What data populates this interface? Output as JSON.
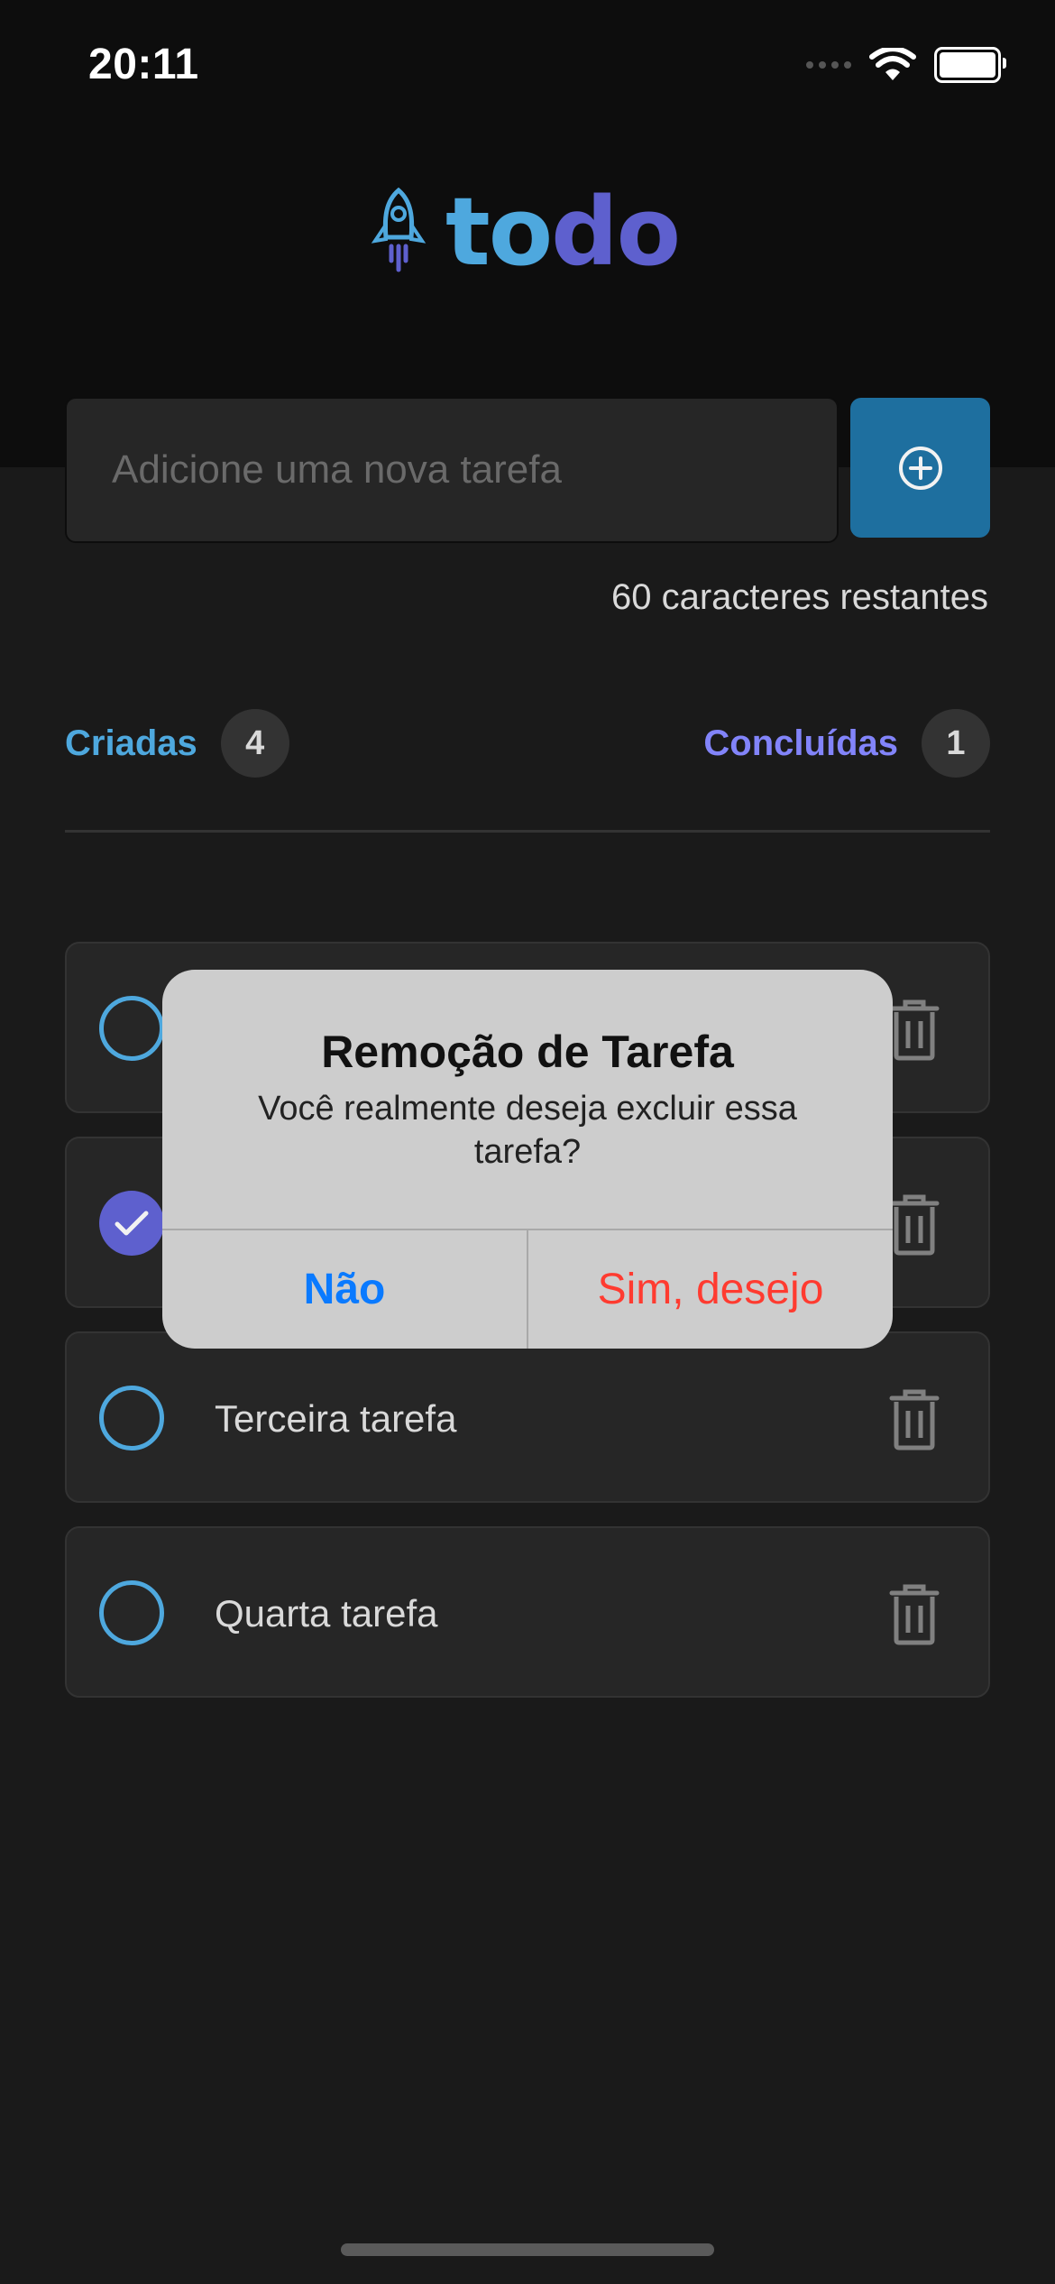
{
  "status_bar": {
    "time": "20:11"
  },
  "logo": {
    "part1": "to",
    "part2": "do"
  },
  "new_task": {
    "placeholder": "Adicione uma nova tarefa",
    "value": ""
  },
  "counter_text": "60 caracteres restantes",
  "tabs": {
    "created_label": "Criadas",
    "created_count": "4",
    "done_label": "Concluídas",
    "done_count": "1"
  },
  "tasks": [
    {
      "text": "",
      "done": false
    },
    {
      "text": "",
      "done": true
    },
    {
      "text": "Terceira tarefa",
      "done": false
    },
    {
      "text": "Quarta tarefa",
      "done": false
    }
  ],
  "alert": {
    "title": "Remoção de Tarefa",
    "message": "Você realmente deseja excluir essa tarefa?",
    "cancel_label": "Não",
    "confirm_label": "Sim, desejo"
  },
  "colors": {
    "primary_blue": "#4ea8de",
    "primary_purple": "#5e60ce",
    "button_blue": "#1e6f9f",
    "danger": "#ff3b30",
    "ios_blue": "#0a7aff"
  }
}
